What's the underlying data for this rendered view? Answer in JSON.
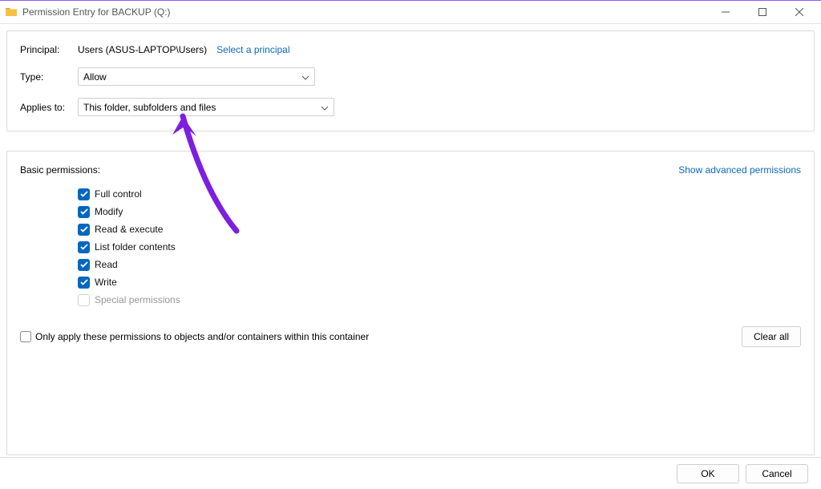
{
  "window": {
    "title": "Permission Entry for BACKUP (Q:)"
  },
  "principal": {
    "label": "Principal:",
    "value": "Users (ASUS-LAPTOP\\Users)",
    "select_link": "Select a principal"
  },
  "type": {
    "label": "Type:",
    "selected": "Allow"
  },
  "applies_to": {
    "label": "Applies to:",
    "selected": "This folder, subfolders and files"
  },
  "basic": {
    "heading": "Basic permissions:",
    "advanced_link": "Show advanced permissions",
    "permissions": {
      "full_control": "Full control",
      "modify": "Modify",
      "read_execute": "Read & execute",
      "list_contents": "List folder contents",
      "read": "Read",
      "write": "Write",
      "special": "Special permissions"
    }
  },
  "only_apply": {
    "label": "Only apply these permissions to objects and/or containers within this container"
  },
  "buttons": {
    "clear_all": "Clear all",
    "ok": "OK",
    "cancel": "Cancel"
  }
}
